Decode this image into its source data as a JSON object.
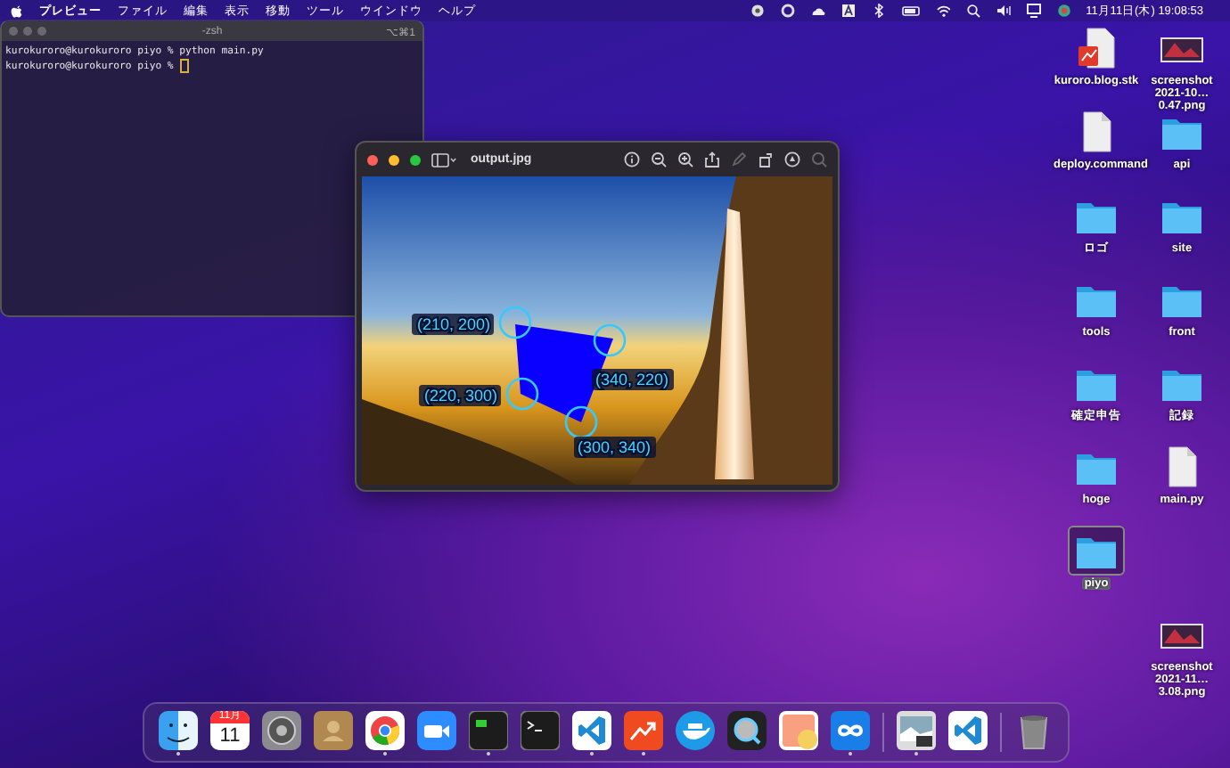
{
  "menubar": {
    "app_name": "プレビュー",
    "menus": [
      "ファイル",
      "編集",
      "表示",
      "移動",
      "ツール",
      "ウインドウ",
      "ヘルプ"
    ],
    "clock": "11月11日(木) 19:08:53"
  },
  "terminal": {
    "title": "-zsh",
    "shortcut": "⌥⌘1",
    "lines": [
      "kurokuroro@kurokuroro piyo % python main.py",
      "kurokuroro@kurokuroro piyo % "
    ]
  },
  "preview": {
    "title": "output.jpg",
    "annotations": [
      "(210, 200)",
      "(340, 220)",
      "(220, 300)",
      "(300, 340)"
    ]
  },
  "desktop_icons": [
    {
      "label": "kuroro.blog.stk",
      "kind": "stickies",
      "selected": false
    },
    {
      "label": "screenshot 2021-10…0.47.png",
      "kind": "screenshot",
      "selected": false
    },
    {
      "label": "deploy.command",
      "kind": "document",
      "selected": false
    },
    {
      "label": "api",
      "kind": "folder",
      "selected": false
    },
    {
      "label": "ロゴ",
      "kind": "folder",
      "selected": false
    },
    {
      "label": "site",
      "kind": "folder",
      "selected": false
    },
    {
      "label": "tools",
      "kind": "folder",
      "selected": false
    },
    {
      "label": "front",
      "kind": "folder",
      "selected": false
    },
    {
      "label": "確定申告",
      "kind": "folder",
      "selected": false
    },
    {
      "label": "記録",
      "kind": "folder",
      "selected": false
    },
    {
      "label": "hoge",
      "kind": "folder",
      "selected": false
    },
    {
      "label": "main.py",
      "kind": "document",
      "selected": false
    },
    {
      "label": "piyo",
      "kind": "folder",
      "selected": true
    },
    {
      "label": "screenshot 2021-11…3.08.png",
      "kind": "screenshot",
      "selected": false
    }
  ],
  "dock": [
    {
      "kind": "finder",
      "running": true
    },
    {
      "kind": "calendar",
      "running": false,
      "month": "11月",
      "day": "11"
    },
    {
      "kind": "settings",
      "running": false
    },
    {
      "kind": "contacts",
      "running": false
    },
    {
      "kind": "chrome",
      "running": true
    },
    {
      "kind": "zoom",
      "running": false
    },
    {
      "kind": "monitor",
      "running": true
    },
    {
      "kind": "terminal",
      "running": false
    },
    {
      "kind": "vscode",
      "running": true
    },
    {
      "kind": "chart",
      "running": true
    },
    {
      "kind": "docker",
      "running": false
    },
    {
      "kind": "quicktime",
      "running": false
    },
    {
      "kind": "stickyapp",
      "running": false
    },
    {
      "kind": "infinity",
      "running": true
    },
    {
      "kind": "divider"
    },
    {
      "kind": "photo",
      "running": true
    },
    {
      "kind": "vscode",
      "running": false
    },
    {
      "kind": "divider"
    },
    {
      "kind": "trash",
      "running": false
    }
  ]
}
